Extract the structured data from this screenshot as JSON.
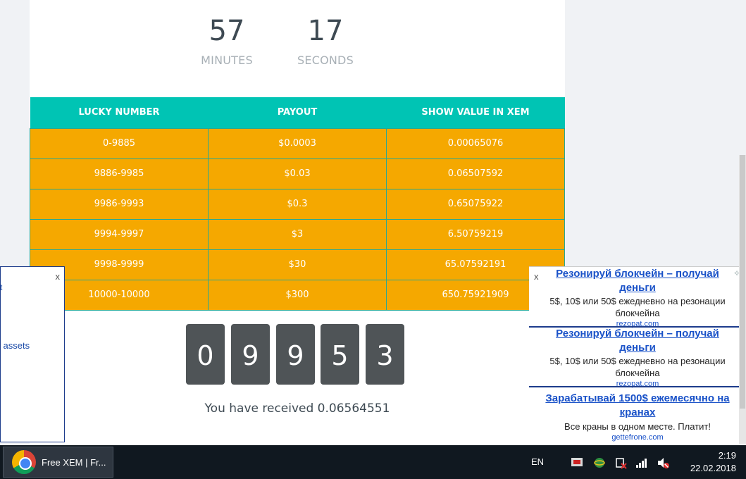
{
  "countdown": {
    "minutes": "57",
    "minutes_label": "MINUTES",
    "seconds": "17",
    "seconds_label": "SECONDS"
  },
  "payout_table": {
    "headers": [
      "LUCKY NUMBER",
      "PAYOUT",
      "SHOW VALUE IN XEM"
    ],
    "rows": [
      [
        "0-9885",
        "$0.0003",
        "0.00065076"
      ],
      [
        "9886-9985",
        "$0.03",
        "0.06507592"
      ],
      [
        "9986-9993",
        "$0.3",
        "0.65075922"
      ],
      [
        "9994-9997",
        "$3",
        "6.50759219"
      ],
      [
        "9998-9999",
        "$30",
        "65.07592191"
      ],
      [
        "10000-10000",
        "$300",
        "650.75921909"
      ]
    ]
  },
  "roll_digits": [
    "0",
    "9",
    "9",
    "5",
    "3"
  ],
  "received_text": "You have received 0.06564551",
  "left_popup": {
    "close": "x",
    "link_t": "t",
    "link_assets": "l assets"
  },
  "right_ads": {
    "close": "x",
    "ads": [
      {
        "title": "Резонируй блокчейн – получай деньги",
        "desc": "5$, 10$ или 50$ ежедневно на резонации блокчейна",
        "domain": "rezopat.com"
      },
      {
        "title": "Резонируй блокчейн – получай деньги",
        "desc": "5$, 10$ или 50$ ежедневно на резонации блокчейна",
        "domain": "rezopat.com"
      },
      {
        "title": "Зарабатывай 1500$ ежемесячно на кранах",
        "desc": "Все краны в одном месте. Платит!",
        "domain": "gettefrone.com"
      }
    ]
  },
  "taskbar": {
    "app_label": "Free XEM | Fr...",
    "language": "EN",
    "time": "2:19",
    "date": "22.02.2018"
  },
  "colors": {
    "table_header": "#00c4b4",
    "table_row": "#f5a800",
    "digit_box": "#4f5457",
    "ad_link": "#1a52c8"
  }
}
